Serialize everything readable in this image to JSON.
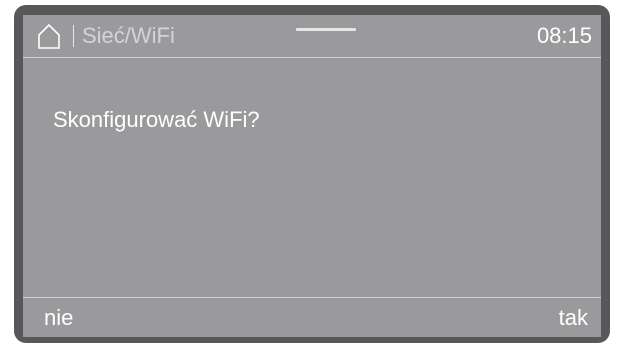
{
  "header": {
    "home_icon": "home-icon",
    "title": "Sieć/WiFi",
    "time": "08:15"
  },
  "dialog": {
    "question": "Skonfigurować WiFi?"
  },
  "softkeys": {
    "left_label": "nie",
    "right_label": "tak"
  },
  "colors": {
    "bezel": "#58585a",
    "screen": "#9a9a9c",
    "text": "#ffffff"
  }
}
